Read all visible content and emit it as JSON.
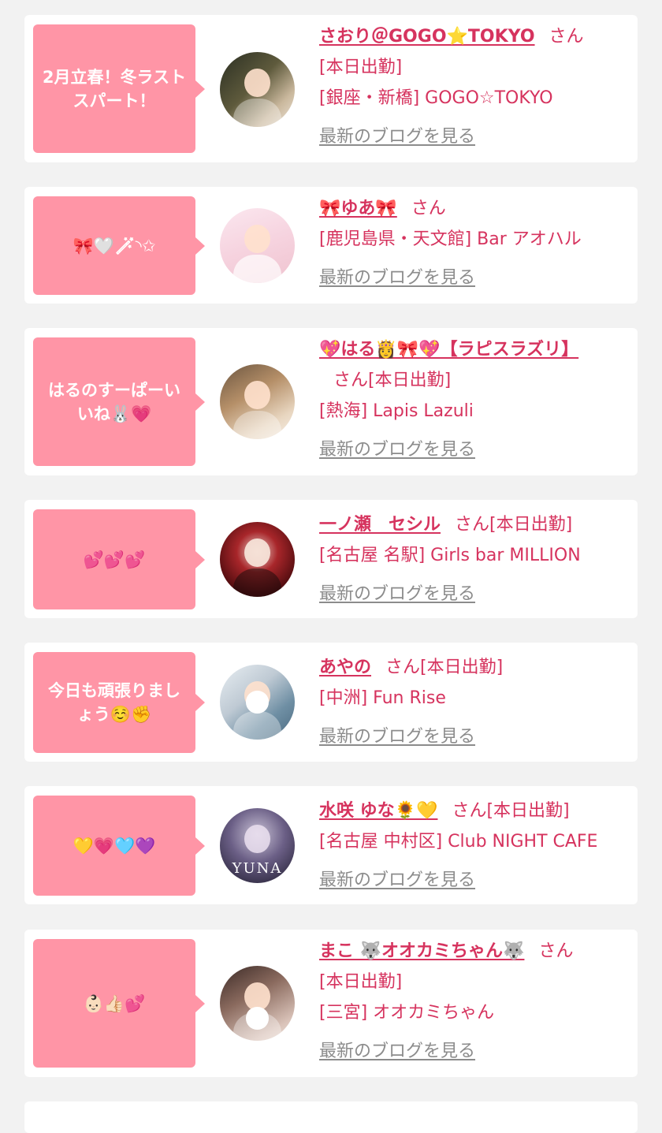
{
  "san_label": "さん",
  "blog_link": "最新のブログを見る",
  "cards": [
    {
      "message": "2月立春！冬ラストスパート！",
      "name": "さおり＠GOGO⭐TOKYO",
      "status": "[本日出勤]",
      "shop": "[銀座・新橋] GOGO☆TOKYO"
    },
    {
      "message": "🎀🤍🪄︎︎◝✩",
      "name": "🎀ゆあ🎀",
      "status": "",
      "shop": "[鹿児島県・天文館] Bar アオハル"
    },
    {
      "message": "はるのすーぱーいいね🐰💗",
      "name": "💖はる👸🎀💖【ラピスラズリ】",
      "status": "[本日出勤]",
      "shop": "[熱海] Lapis Lazuli"
    },
    {
      "message": "💕💕💕",
      "name": "一ノ瀬　セシル",
      "status": "[本日出勤]",
      "shop": "[名古屋 名駅] Girls bar MILLION"
    },
    {
      "message": "今日も頑張りましょう☺️✊",
      "name": "あやの",
      "status": "[本日出勤]",
      "shop": "[中洲] Fun Rise"
    },
    {
      "message": "💛💗🩵💜",
      "name": "水咲 ゆな🌻💛",
      "status": "[本日出勤]",
      "shop": "[名古屋 中村区] Club NIGHT CAFE",
      "avatar_caption": "YUNA"
    },
    {
      "message": "👶🏻👍🏻💕",
      "name": "まこ 🐺オオカミちゃん🐺",
      "status": "[本日出勤]",
      "shop": "[三宮] オオカミちゃん"
    }
  ]
}
